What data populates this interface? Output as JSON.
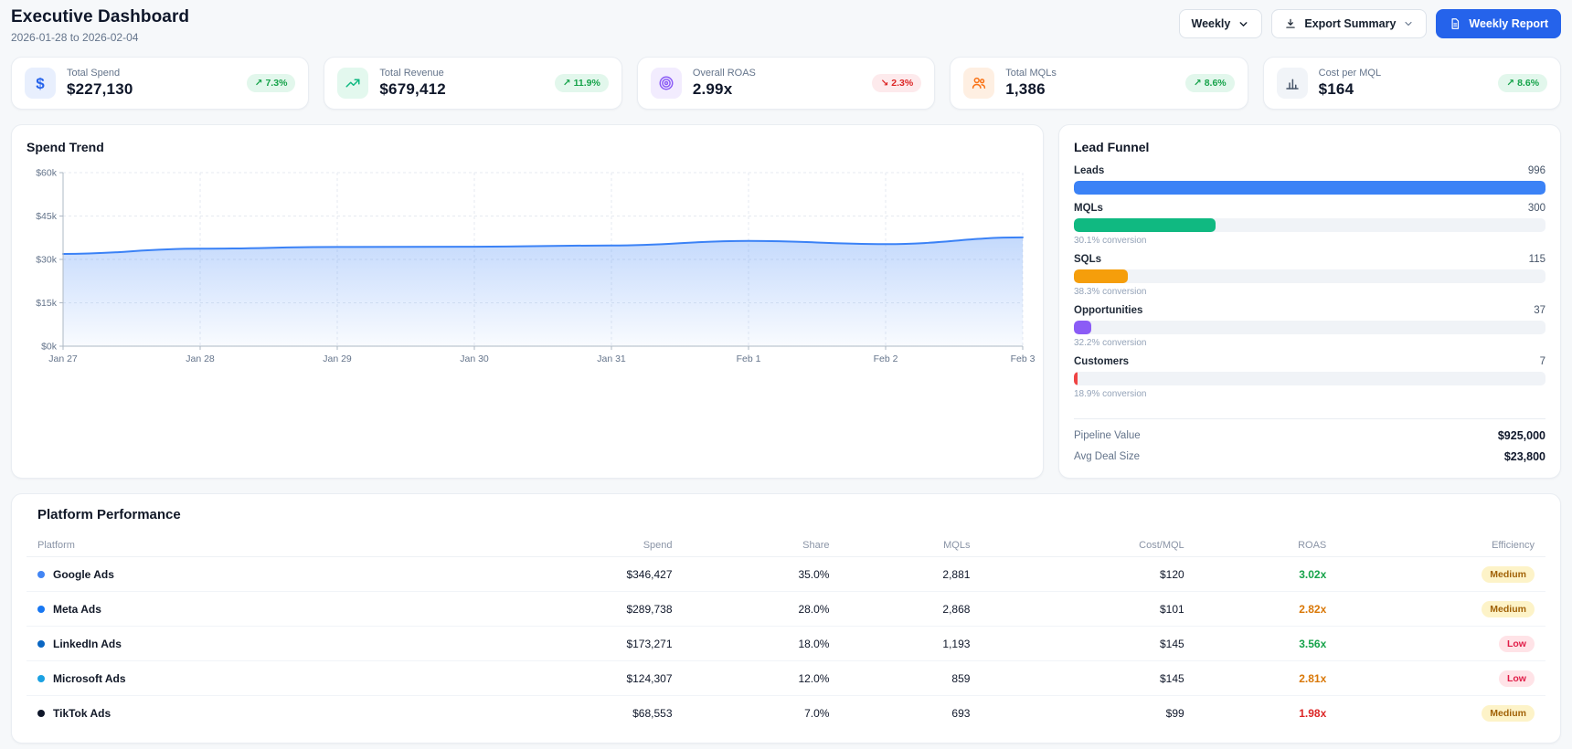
{
  "header": {
    "title": "Executive Dashboard",
    "date_range": "2026-01-28 to 2026-02-04",
    "period_select": {
      "value": "Weekly",
      "icon": "chevron-down-icon"
    },
    "export_button": {
      "label": "Export Summary",
      "icon": "download-icon",
      "chevron": "chevron-down-icon"
    },
    "report_button": {
      "label": "Weekly Report",
      "icon": "document-icon",
      "color": "#2563eb"
    }
  },
  "kpis": [
    {
      "label": "Total Spend",
      "value": "$227,130",
      "delta": "7.3%",
      "arrow": "up",
      "tone": "positive",
      "icon": "dollar-icon",
      "icon_color": "#2563eb",
      "icon_bg": "#e8effd"
    },
    {
      "label": "Total Revenue",
      "value": "$679,412",
      "delta": "11.9%",
      "arrow": "up",
      "tone": "positive",
      "icon": "trending-up-icon",
      "icon_color": "#10b981",
      "icon_bg": "#e3f8ee"
    },
    {
      "label": "Overall ROAS",
      "value": "2.99x",
      "delta": "2.3%",
      "arrow": "down",
      "tone": "negative",
      "icon": "target-icon",
      "icon_color": "#8b5cf6",
      "icon_bg": "#f2ecfe"
    },
    {
      "label": "Total MQLs",
      "value": "1,386",
      "delta": "8.6%",
      "arrow": "up",
      "tone": "positive",
      "icon": "users-icon",
      "icon_color": "#f97316",
      "icon_bg": "#feefe2"
    },
    {
      "label": "Cost per MQL",
      "value": "$164",
      "delta": "8.6%",
      "arrow": "up",
      "tone": "positive",
      "icon": "bar-chart-icon",
      "icon_color": "#475569",
      "icon_bg": "#f1f4f8"
    }
  ],
  "chart_data": {
    "type": "area",
    "title": "Spend Trend",
    "x": [
      "Jan 27",
      "Jan 28",
      "Jan 29",
      "Jan 30",
      "Jan 31",
      "Feb 1",
      "Feb 2",
      "Feb 3"
    ],
    "values": [
      31900,
      33700,
      34300,
      34400,
      34800,
      36400,
      35300,
      37600
    ],
    "ylim": [
      0,
      60000
    ],
    "ytick_values": [
      0,
      15000,
      30000,
      45000,
      60000
    ],
    "ytick_labels": [
      "$0k",
      "$15k",
      "$30k",
      "$45k",
      "$60k"
    ],
    "grid": "dashed",
    "legend": "none",
    "line_color": "#3b82f6",
    "fill_top": "rgba(59,130,246,0.30)",
    "fill_bottom": "rgba(59,130,246,0.03)"
  },
  "funnel": {
    "title": "Lead Funnel",
    "stages": [
      {
        "label": "Leads",
        "value": "996",
        "width_pct": 100,
        "color": "#3b82f6",
        "conversion": ""
      },
      {
        "label": "MQLs",
        "value": "300",
        "width_pct": 30.1,
        "color": "#10b981",
        "conversion": "30.1% conversion"
      },
      {
        "label": "SQLs",
        "value": "115",
        "width_pct": 11.5,
        "color": "#f59e0b",
        "conversion": "38.3% conversion"
      },
      {
        "label": "Opportunities",
        "value": "37",
        "width_pct": 3.7,
        "color": "#8b5cf6",
        "conversion": "32.2% conversion"
      },
      {
        "label": "Customers",
        "value": "7",
        "width_pct": 0.7,
        "color": "#ef4444",
        "conversion": "18.9% conversion"
      }
    ],
    "stats": [
      {
        "label": "Pipeline Value",
        "value": "$925,000"
      },
      {
        "label": "Avg Deal Size",
        "value": "$23,800"
      }
    ]
  },
  "table": {
    "title": "Platform Performance",
    "columns": [
      "Platform",
      "Spend",
      "Share",
      "MQLs",
      "Cost/MQL",
      "ROAS",
      "Efficiency"
    ],
    "rows": [
      {
        "platform": "Google Ads",
        "dot_color": "#4285F4",
        "spend": "$346,427",
        "share": "35.0%",
        "mqls": "2,881",
        "cost_per_mql": "$120",
        "roas": "3.02x",
        "roas_color": "#16a34a",
        "efficiency": "Medium",
        "efficiency_tone": "medium"
      },
      {
        "platform": "Meta Ads",
        "dot_color": "#1877F2",
        "spend": "$289,738",
        "share": "28.0%",
        "mqls": "2,868",
        "cost_per_mql": "$101",
        "roas": "2.82x",
        "roas_color": "#d97706",
        "efficiency": "Medium",
        "efficiency_tone": "medium"
      },
      {
        "platform": "LinkedIn Ads",
        "dot_color": "#0A66C2",
        "spend": "$173,271",
        "share": "18.0%",
        "mqls": "1,193",
        "cost_per_mql": "$145",
        "roas": "3.56x",
        "roas_color": "#16a34a",
        "efficiency": "Low",
        "efficiency_tone": "low"
      },
      {
        "platform": "Microsoft Ads",
        "dot_color": "#1BA1E2",
        "spend": "$124,307",
        "share": "12.0%",
        "mqls": "859",
        "cost_per_mql": "$145",
        "roas": "2.81x",
        "roas_color": "#d97706",
        "efficiency": "Low",
        "efficiency_tone": "low"
      },
      {
        "platform": "TikTok Ads",
        "dot_color": "#0f172a",
        "spend": "$68,553",
        "share": "7.0%",
        "mqls": "693",
        "cost_per_mql": "$99",
        "roas": "1.98x",
        "roas_color": "#dc2626",
        "efficiency": "Medium",
        "efficiency_tone": "medium"
      }
    ]
  }
}
